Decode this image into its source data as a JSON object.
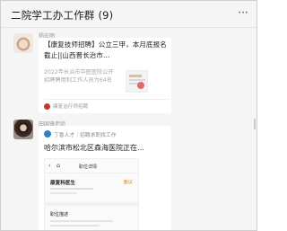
{
  "header": {
    "title": "二院学工办工作群 (9)",
    "more_icon": "ellipsis-icon"
  },
  "messages": [
    {
      "sender": "杨宏雨",
      "avatar": "avatar-icon",
      "card": {
        "title": "【康复技师招聘】公立三甲，本月底报名截止||山西晋长治市…",
        "description": "2022年长治市中医医院公开招聘聘用制工作人员为64名",
        "thumbnail": "article-thumbnail",
        "source": "康复治疗师招聘",
        "source_icon": "official-account-icon"
      }
    },
    {
      "sender": "田国锋老师",
      "avatar": "avatar-icon",
      "card": {
        "source": "丁香人才｜招聘求职找工作",
        "source_icon": "miniprogram-icon",
        "title": "哈尔滨市松北区森海医院正在…",
        "preview": {
          "header": "职位详情",
          "job_title": "康复科医生",
          "salary": "面议",
          "section": "职位描述"
        }
      }
    }
  ],
  "colors": {
    "background": "#f5f5f5",
    "card": "#ffffff",
    "salary": "#e08a2a"
  }
}
